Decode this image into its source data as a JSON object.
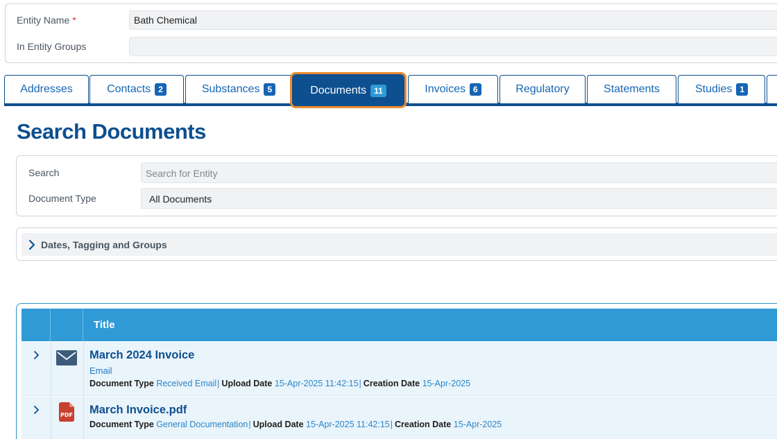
{
  "entity": {
    "name_label": "Entity Name",
    "required_mark": "*",
    "name_value": "Bath Chemical",
    "groups_label": "In Entity Groups",
    "groups_value": ""
  },
  "tabs": [
    {
      "label": "Addresses",
      "badge": ""
    },
    {
      "label": "Contacts",
      "badge": "2"
    },
    {
      "label": "Substances",
      "badge": "5"
    },
    {
      "label": "Documents",
      "badge": "11"
    },
    {
      "label": "Invoices",
      "badge": "6"
    },
    {
      "label": "Regulatory",
      "badge": ""
    },
    {
      "label": "Statements",
      "badge": ""
    },
    {
      "label": "Studies",
      "badge": "1"
    }
  ],
  "active_tab": "Documents",
  "page_title": "Search Documents",
  "search": {
    "search_label": "Search",
    "search_placeholder": "Search for Entity",
    "type_label": "Document Type",
    "type_value": "All Documents"
  },
  "filters": {
    "collapsed_label": "Dates, Tagging and Groups"
  },
  "table": {
    "title_header": "Title",
    "rows": [
      {
        "icon": "envelope-icon",
        "title": "March 2024 Invoice",
        "subtitle": "Email",
        "doc_type_label": "Document Type",
        "doc_type": "Received Email",
        "upload_label": "Upload Date",
        "upload_date": "15-Apr-2025 11:42:15",
        "creation_label": "Creation Date",
        "creation_date": "15-Apr-2025"
      },
      {
        "icon": "pdf-icon",
        "title": "March Invoice.pdf",
        "subtitle": "",
        "doc_type_label": "Document Type",
        "doc_type": "General Documentation",
        "upload_label": "Upload Date",
        "upload_date": "15-Apr-2025 11:42:15",
        "creation_label": "Creation Date",
        "creation_date": "15-Apr-2025"
      }
    ]
  },
  "colors": {
    "primary": "#0d4f8f",
    "accent": "#2f9ad6",
    "highlight": "#ec8a2e",
    "pdf_red": "#c8402f"
  }
}
